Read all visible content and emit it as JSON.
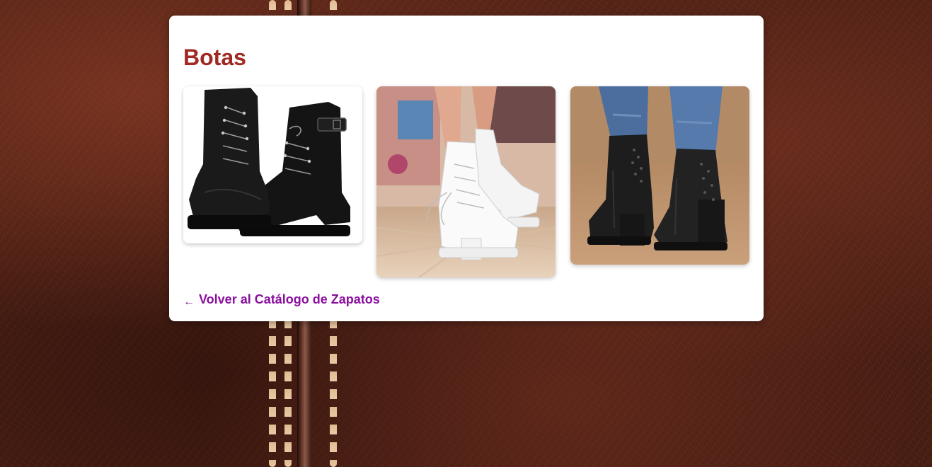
{
  "page": {
    "title": "Botas"
  },
  "gallery": {
    "images": [
      {
        "alt": "black lace-up combat boots",
        "icon": "boot-black-lace"
      },
      {
        "alt": "white lace-up platform ankle boots",
        "icon": "boot-white-lace"
      },
      {
        "alt": "black studded heeled ankle boots",
        "icon": "boot-black-heel"
      }
    ]
  },
  "nav": {
    "back_arrow": "←",
    "back_label": "Volver al Catálogo de Zapatos"
  },
  "colors": {
    "title": "#a02a22",
    "link": "#8a0f9e",
    "card_background": "#ffffff"
  }
}
